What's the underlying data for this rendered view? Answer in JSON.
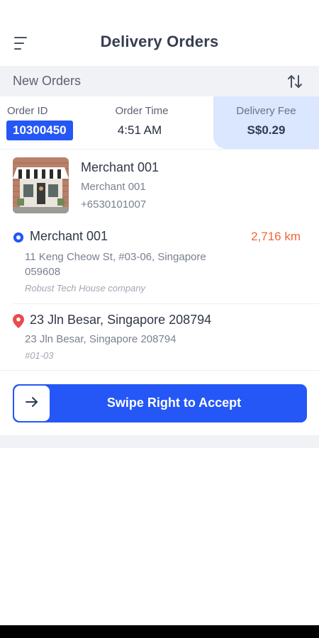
{
  "header": {
    "title": "Delivery Orders",
    "menu_icon": "menu-icon"
  },
  "section": {
    "title": "New Orders",
    "sort_icon": "sort-icon"
  },
  "order": {
    "id_label": "Order ID",
    "id": "10300450",
    "time_label": "Order Time",
    "time": "4:51 AM",
    "fee_label": "Delivery Fee",
    "fee": "S$0.29"
  },
  "merchant": {
    "name": "Merchant 001",
    "subtitle": "Merchant 001",
    "phone": "+6530101007"
  },
  "pickup": {
    "name": "Merchant 001",
    "distance": "2,716 km",
    "address": "11 Keng Cheow St, #03-06, Singapore 059608",
    "note": "Robust Tech House company"
  },
  "dropoff": {
    "name": "23 Jln Besar, Singapore 208794",
    "address": "23 Jln Besar, Singapore 208794",
    "unit": "#01-03"
  },
  "swipe": {
    "label": "Swipe Right to Accept",
    "icon": "arrow-right-icon"
  },
  "colors": {
    "accent": "#2457f5",
    "fee_bg": "#dbe6ff",
    "distance": "#f2653a",
    "drop_pin": "#e94b4b"
  }
}
